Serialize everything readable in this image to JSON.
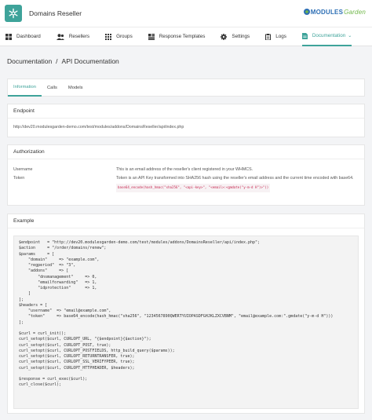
{
  "app": {
    "title": "Domains Reseller"
  },
  "brand": {
    "part1": "MODULES",
    "part2": "Garden"
  },
  "nav": [
    {
      "label": "Dashboard",
      "icon": "dashboard-icon"
    },
    {
      "label": "Resellers",
      "icon": "users-icon"
    },
    {
      "label": "Groups",
      "icon": "grid-icon"
    },
    {
      "label": "Response Templates",
      "icon": "templates-icon"
    },
    {
      "label": "Settings",
      "icon": "gear-icon"
    },
    {
      "label": "Logs",
      "icon": "clipboard-icon"
    },
    {
      "label": "Documentation",
      "icon": "document-icon",
      "active": true
    }
  ],
  "breadcrumb": {
    "root": "Documentation",
    "separator": "/",
    "current": "API Documentation"
  },
  "tabs": [
    {
      "label": "Information",
      "active": true
    },
    {
      "label": "Calls"
    },
    {
      "label": "Models"
    }
  ],
  "endpoint": {
    "title": "Endpoint",
    "url": "http://dev20.modulesgarden-demo.com/test/modules/addons/DomainsReseller/api/index.php"
  },
  "authorization": {
    "title": "Authorization",
    "username_label": "Username",
    "username_value": "This is an email address of the reseller's client registered in your WHMCS.",
    "token_label": "Token",
    "token_value": "Token is an API Key transformed into SHA256 hash using the reseller's email address and the current time encoded with base64.",
    "token_code": "base64_encode(hash_hmac(\"sha256\", \"<api-key>\", \"<email>:<gmdate(\"y-m-d H\")>\"))"
  },
  "example": {
    "title": "Example",
    "code": "$endpoint   = \"http://dev20.modulesgarden-demo.com/test/modules/addons/DomainsReseller/api/index.php\";\n$action     = \"/order/domains/renew\";\n$params     = [\n    \"domain\"     => \"example.com\",\n    \"regperiod\"  => \"3\",\n    \"addons\"     => [\n        \"dnsmanagement\"     => 0,\n        \"emailforwarding\"   => 1,\n        \"idprotection\"      => 1,\n    ]\n];\n$headers = [\n    \"username\"  => \"email@example.com\",\n    \"token\"     => base64_encode(hash_hmac(\"sha256\", \"1234567890QWERTYUIOPASDFGHJKLZXCVBNM\", \"email@example.com:\".gmdate(\"y-m-d H\")))\n];\n\n$curl = curl_init();\ncurl_setopt($curl, CURLOPT_URL, \"{$endpoint}{$action}\");\ncurl_setopt($curl, CURLOPT_POST, true);\ncurl_setopt($curl, CURLOPT_POSTFIELDS, http_build_query($params));\ncurl_setopt($curl, CURLOPT_RETURNTRANSFER, true);\ncurl_setopt($curl, CURLOPT_SSL_VERIFYPEER, true);\ncurl_setopt($curl, CURLOPT_HTTPHEADER, $headers);\n\n$response = curl_exec($curl);\ncurl_close($curl);"
  },
  "colors": {
    "accent": "#3ea39a",
    "code_red": "#c7254e",
    "brand_blue": "#2d6fb5",
    "brand_green": "#71b84a"
  }
}
